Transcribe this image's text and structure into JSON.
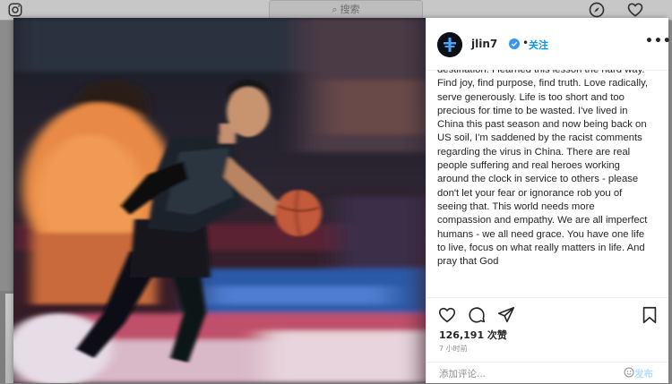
{
  "topbar": {
    "search_placeholder": "搜索",
    "icons": [
      "instagram-logo-icon",
      "compass-icon",
      "heart-icon"
    ]
  },
  "post": {
    "username": "jlin7",
    "separator": "•",
    "follow_label": "关注",
    "more_label": "•••",
    "caption": "destination. I learned this lesson the hard way. Find joy, find purpose, find truth. Love radically, serve generously. Life is too short and too precious for time to be wasted. I've lived in China this past season and now being back on US soil, I'm saddened by the racist comments regarding the virus in China. There are real people suffering and real heroes working around the clock in service to others - please don't let your fear or ignorance rob you of seeing that. This world needs more compassion and empathy. We are all imperfect humans - we all need grace. You have one life to live, focus on what really matters in life. And pray that God",
    "likes": "126,191 次赞",
    "time_ago": "7 小时前",
    "comment_placeholder": "添加评论...",
    "post_label": "发布",
    "colors": {
      "accent": "#0095f6",
      "verified": "#3897f0",
      "text": "#262626",
      "muted": "#8e8e8e"
    },
    "action_icons": [
      "heart-icon",
      "comment-icon",
      "share-icon",
      "bookmark-icon"
    ]
  }
}
